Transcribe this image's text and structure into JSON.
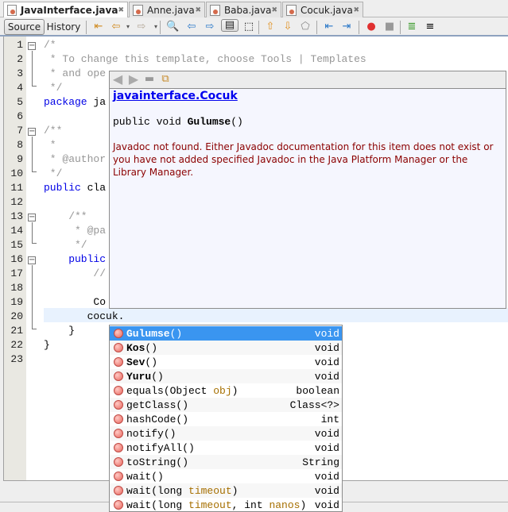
{
  "tabs": [
    {
      "label": "JavaInterface.java",
      "active": true
    },
    {
      "label": "Anne.java"
    },
    {
      "label": "Baba.java"
    },
    {
      "label": "Cocuk.java"
    }
  ],
  "toolbar": {
    "source_label": "Source",
    "history_label": "History"
  },
  "editor": {
    "line_numbers": [
      "1",
      "2",
      "3",
      "4",
      "5",
      "6",
      "7",
      "8",
      "9",
      "10",
      "11",
      "12",
      "13",
      "14",
      "15",
      "16",
      "17",
      "18",
      "19",
      "20",
      "21",
      "22",
      "23"
    ],
    "lines": {
      "l1": "/*",
      "l2": " * To change this template, choose Tools | Templates",
      "l3": " * and ope",
      "l4": " */",
      "l5_kw": "package",
      "l5": " ja",
      "l7": "/**",
      "l8": " *",
      "l9": " * @author",
      "l10": " */",
      "l11_kw": "public",
      "l11": " cla",
      "l13": "    /**",
      "l14": "     * @pa",
      "l15": "     */",
      "l16_kw": "    public",
      "l17": "        //",
      "l19": "        Co",
      "l20": "       cocuk.",
      "l21": "    }",
      "l22": "}"
    }
  },
  "javadoc": {
    "class_link": "javainterface.Cocuk",
    "signature_prefix": "public void ",
    "signature_name": "Gulumse",
    "signature_suffix": "()",
    "message": "Javadoc not found. Either Javadoc documentation for this item does not exist or you have not added specified Javadoc in the Java Platform Manager or the Library Manager."
  },
  "completion": [
    {
      "name": "Gulumse",
      "args": "()",
      "ret": "void",
      "bold": true,
      "selected": true
    },
    {
      "name": "Kos",
      "args": "()",
      "ret": "void",
      "bold": true
    },
    {
      "name": "Sev",
      "args": "()",
      "ret": "void",
      "bold": true
    },
    {
      "name": "Yuru",
      "args": "()",
      "ret": "void",
      "bold": true
    },
    {
      "name": "equals",
      "args_pre": "(Object ",
      "param1": "obj",
      "args_post": ")",
      "ret": "boolean"
    },
    {
      "name": "getClass",
      "args": "()",
      "ret": "Class<?>"
    },
    {
      "name": "hashCode",
      "args": "()",
      "ret": "int"
    },
    {
      "name": "notify",
      "args": "()",
      "ret": "void"
    },
    {
      "name": "notifyAll",
      "args": "()",
      "ret": "void"
    },
    {
      "name": "toString",
      "args": "()",
      "ret": "String"
    },
    {
      "name": "wait",
      "args": "()",
      "ret": "void"
    },
    {
      "name": "wait",
      "args_pre": "(long ",
      "param1": "timeout",
      "args_post": ")",
      "ret": "void"
    },
    {
      "name": "wait",
      "args_pre": "(long ",
      "param1": "timeout",
      "args_mid": ", int ",
      "param2": "nanos",
      "args_post": ")",
      "ret": "void"
    }
  ],
  "colors": {
    "selection": "#3a95f0",
    "link": "#0000ee",
    "keyword": "#0000e6",
    "comment": "#969696",
    "param": "#a66f00",
    "error_text": "#8b0000"
  }
}
